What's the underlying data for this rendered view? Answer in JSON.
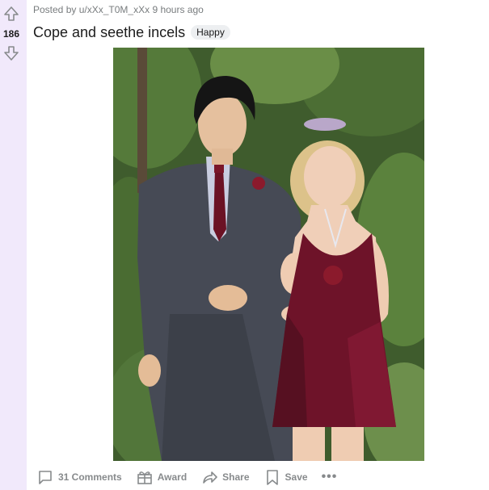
{
  "post": {
    "vote_count": "186",
    "meta_prefix": "Posted by",
    "author": "u/xXx_T0M_xXx",
    "timestamp": "9 hours ago",
    "title": "Cope and seethe incels",
    "flair": "Happy"
  },
  "actions": {
    "comments_label": "31 Comments",
    "award_label": "Award",
    "share_label": "Share",
    "save_label": "Save",
    "more_label": "•••"
  },
  "icons": {
    "upvote": "upvote-arrow-icon",
    "downvote": "downvote-arrow-icon",
    "comments": "comment-bubble-icon",
    "award": "gift-icon",
    "share": "share-arrow-icon",
    "save": "bookmark-icon",
    "more": "more-dots-icon"
  },
  "colors": {
    "vote_rail_bg": "#f1e9fb",
    "muted_text": "#878a8c",
    "flair_bg": "#edeff1"
  }
}
